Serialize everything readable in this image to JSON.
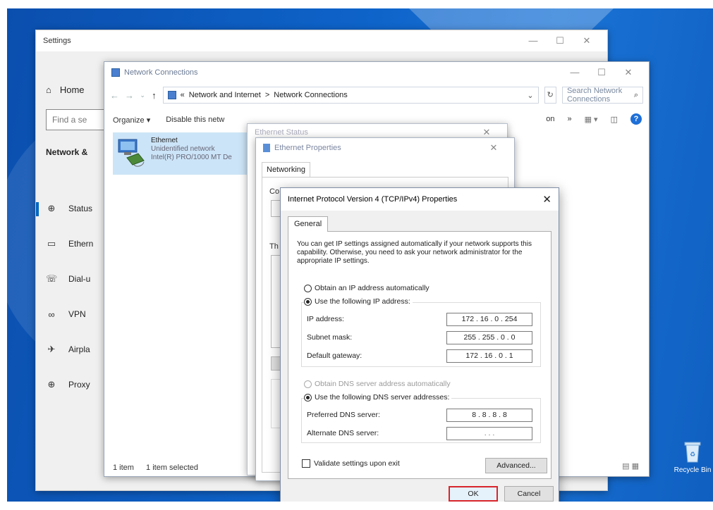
{
  "settings": {
    "title": "Settings",
    "home_label": "Home",
    "search_placeholder": "Find a se",
    "section_label": "Network &",
    "nav": [
      {
        "label": "Status",
        "icon": "globe-icon",
        "active": true
      },
      {
        "label": "Ethern",
        "icon": "ethernet-icon"
      },
      {
        "label": "Dial-u",
        "icon": "dialup-icon"
      },
      {
        "label": "VPN",
        "icon": "vpn-icon"
      },
      {
        "label": "Airpla",
        "icon": "airplane-icon"
      },
      {
        "label": "Proxy",
        "icon": "proxy-icon"
      }
    ]
  },
  "netconn": {
    "title": "Network Connections",
    "address": {
      "prefix": "«",
      "crumb1": "Network and Internet",
      "sep": ">",
      "crumb2": "Network Connections"
    },
    "search_placeholder": "Search Network Connections",
    "cmd": {
      "organize": "Organize ▾",
      "disable": "Disable this netw",
      "more": "»",
      "partial": "on"
    },
    "item": {
      "name": "Ethernet",
      "status": "Unidentified network",
      "adapter": "Intel(R) PRO/1000 MT De"
    },
    "statusbar": {
      "count": "1 item",
      "selected": "1 item selected"
    }
  },
  "ethstatus": {
    "title": "Ethernet Status"
  },
  "ethprops": {
    "title": "Ethernet Properties",
    "tab": "Networking",
    "connect_label": "Co",
    "list_label": "Th"
  },
  "ipv4": {
    "title": "Internet Protocol Version 4 (TCP/IPv4) Properties",
    "tab": "General",
    "intro": "You can get IP settings assigned automatically if your network supports this capability. Otherwise, you need to ask your network administrator for the appropriate IP settings.",
    "ip_auto": "Obtain an IP address automatically",
    "ip_manual": "Use the following IP address:",
    "ip_label": "IP address:",
    "ip_value": "172 . 16 . 0 . 254",
    "mask_label": "Subnet mask:",
    "mask_value": "255 . 255 . 0 . 0",
    "gw_label": "Default gateway:",
    "gw_value": "172 . 16 . 0 . 1",
    "dns_auto": "Obtain DNS server address automatically",
    "dns_manual": "Use the following DNS server addresses:",
    "pdns_label": "Preferred DNS server:",
    "pdns_value": "8 . 8 . 8 . 8",
    "adns_label": "Alternate DNS server:",
    "adns_value": ". . .",
    "validate": "Validate settings upon exit",
    "advanced": "Advanced...",
    "ok": "OK",
    "cancel": "Cancel",
    "highlight_color": "#d9252b"
  },
  "desktop": {
    "recycle_bin": "Recycle Bin"
  }
}
